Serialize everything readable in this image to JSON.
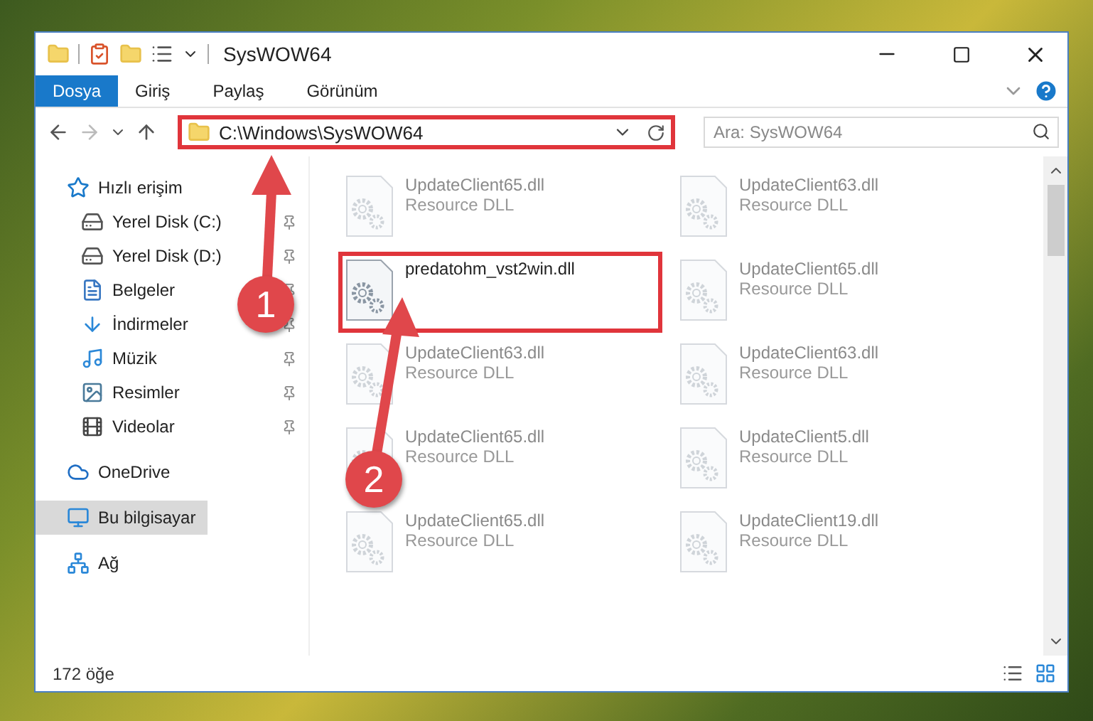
{
  "window": {
    "title": "SysWOW64"
  },
  "ribbon_tabs": [
    {
      "label": "Dosya",
      "selected": true
    },
    {
      "label": "Giriş",
      "selected": false
    },
    {
      "label": "Paylaş",
      "selected": false
    },
    {
      "label": "Görünüm",
      "selected": false
    }
  ],
  "address": {
    "path": "C:\\Windows\\SysWOW64",
    "highlighted": true
  },
  "search": {
    "placeholder": "Ara: SysWOW64"
  },
  "sidebar": {
    "items": [
      {
        "label": "Hızlı erişim",
        "selected": false,
        "children": [
          {
            "label": "Yerel Disk (C:)",
            "pinned": true,
            "selected": false
          },
          {
            "label": "Yerel Disk (D:)",
            "pinned": true,
            "selected": false
          },
          {
            "label": "Belgeler",
            "pinned": true,
            "selected": false
          },
          {
            "label": "İndirmeler",
            "pinned": true,
            "selected": false
          },
          {
            "label": "Müzik",
            "pinned": true,
            "selected": false
          },
          {
            "label": "Resimler",
            "pinned": true,
            "selected": false
          },
          {
            "label": "Videolar",
            "pinned": true,
            "selected": false
          }
        ]
      },
      {
        "label": "OneDrive",
        "selected": false
      },
      {
        "label": "Bu bilgisayar",
        "selected": true
      },
      {
        "label": "Ağ",
        "selected": false
      }
    ]
  },
  "files": [
    {
      "name": "UpdateClient65.dll",
      "type": "Resource DLL",
      "faded": true,
      "highlighted": false
    },
    {
      "name": "UpdateClient63.dll",
      "type": "Resource DLL",
      "faded": true,
      "highlighted": false
    },
    {
      "name": "predatohm_vst2win.dll",
      "faded": false,
      "highlighted": true
    },
    {
      "name": "UpdateClient65.dll",
      "type": "Resource DLL",
      "faded": true,
      "highlighted": false
    },
    {
      "name": "UpdateClient63.dll",
      "type": "Resource DLL",
      "faded": true,
      "highlighted": false
    },
    {
      "name": "UpdateClient63.dll",
      "type": "Resource DLL",
      "faded": true,
      "highlighted": false
    },
    {
      "name": "UpdateClient65.dll",
      "type": "Resource DLL",
      "faded": true,
      "highlighted": false
    },
    {
      "name": "UpdateClient5.dll",
      "type": "Resource DLL",
      "faded": true,
      "highlighted": false
    },
    {
      "name": "UpdateClient65.dll",
      "type": "Resource DLL",
      "faded": true,
      "highlighted": false
    },
    {
      "name": "UpdateClient19.dll",
      "type": "Resource DLL",
      "faded": true,
      "highlighted": false
    }
  ],
  "callouts": [
    {
      "number": "1"
    },
    {
      "number": "2"
    }
  ],
  "status_bar": {
    "count": "172 öğe"
  }
}
